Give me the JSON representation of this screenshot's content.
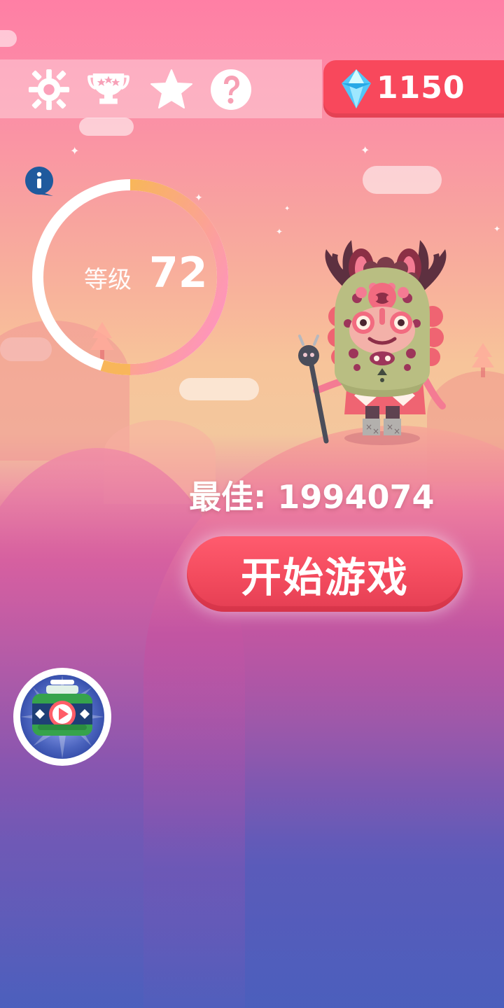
{
  "hud": {
    "gems": "1150",
    "icons": {
      "settings": "gear-icon",
      "trophies": "trophy-icon",
      "favorites": "star-icon",
      "help": "question-icon"
    }
  },
  "level": {
    "label": "等级",
    "value": "72",
    "progress": 0.35
  },
  "best_score": {
    "label": "最佳:",
    "value": "1994074"
  },
  "actions": {
    "start_game": "开始游戏"
  },
  "colors": {
    "accent": "#f8485c",
    "ring_start": "#f8b65a",
    "ring_end": "#ff8fcb",
    "info": "#1f5a9d",
    "gem": "#51c2f5"
  }
}
